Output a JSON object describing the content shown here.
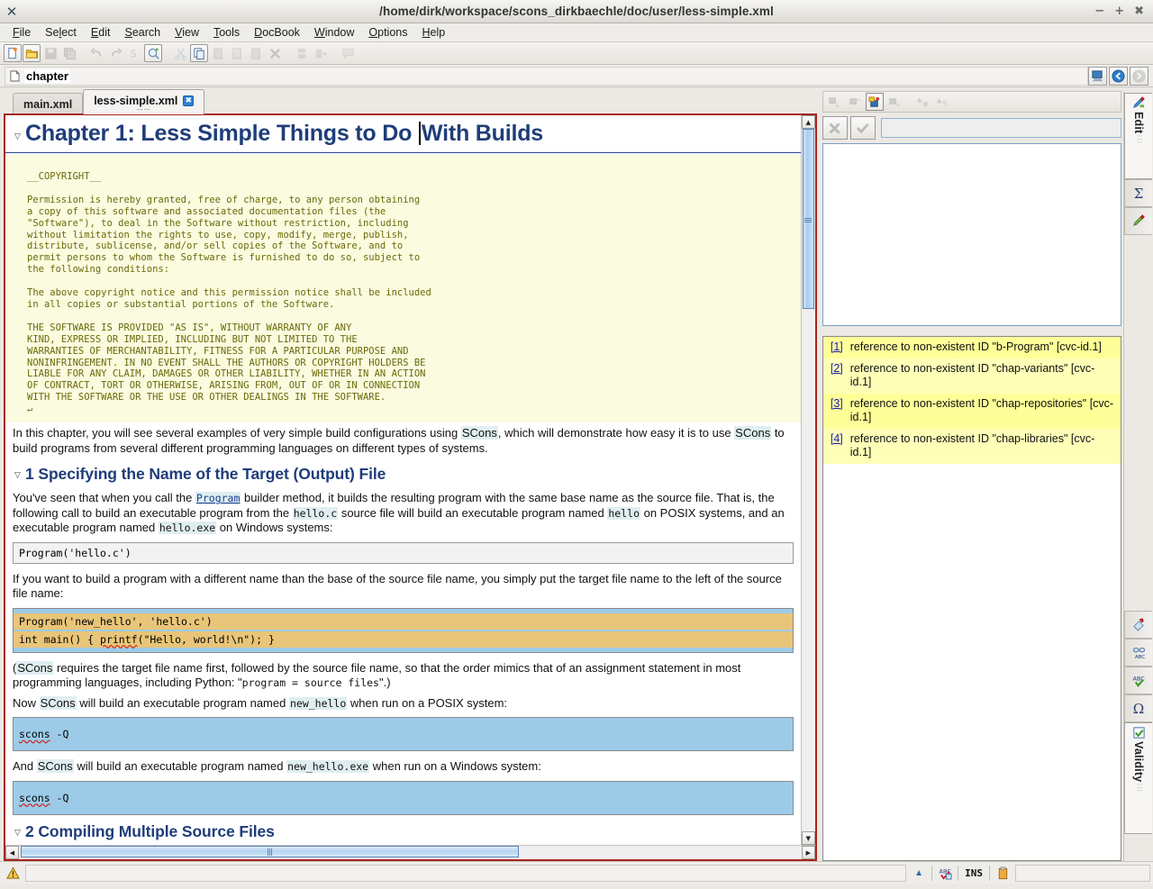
{
  "window": {
    "title": "/home/dirk/workspace/scons_dirkbaechle/doc/user/less-simple.xml",
    "app_icon": "x-icon",
    "minimize": "−",
    "maximize": "+",
    "close": "✖"
  },
  "menubar": {
    "items": [
      {
        "label": "File",
        "accel": "F"
      },
      {
        "label": "Select",
        "accel": "l"
      },
      {
        "label": "Edit",
        "accel": "E"
      },
      {
        "label": "Search",
        "accel": "S"
      },
      {
        "label": "View",
        "accel": "V"
      },
      {
        "label": "Tools",
        "accel": "T"
      },
      {
        "label": "DocBook",
        "accel": "D"
      },
      {
        "label": "Window",
        "accel": "W"
      },
      {
        "label": "Options",
        "accel": "O"
      },
      {
        "label": "Help",
        "accel": "H"
      }
    ]
  },
  "toolbar": {
    "buttons": [
      {
        "name": "new-file-icon",
        "enabled": true
      },
      {
        "name": "open-folder-icon",
        "enabled": true
      },
      {
        "name": "save-icon",
        "enabled": false
      },
      {
        "name": "save-all-icon",
        "enabled": false
      },
      {
        "name": "undo-icon",
        "enabled": false
      },
      {
        "name": "redo-icon",
        "enabled": false
      },
      {
        "name": "spellcheck-icon",
        "enabled": false
      },
      {
        "name": "search-preview-icon",
        "enabled": true
      },
      {
        "name": "cut-icon",
        "enabled": false
      },
      {
        "name": "copy-icon",
        "enabled": true
      },
      {
        "name": "paste-before-icon",
        "enabled": false
      },
      {
        "name": "paste-icon",
        "enabled": false
      },
      {
        "name": "paste-after-icon",
        "enabled": false
      },
      {
        "name": "delete-icon",
        "enabled": false
      },
      {
        "name": "split-icon",
        "enabled": false
      },
      {
        "name": "join-icon",
        "enabled": false
      },
      {
        "name": "comment-icon",
        "enabled": false
      }
    ]
  },
  "breadcrumb": {
    "path_icon": "document-icon",
    "label": "chapter",
    "right_buttons": [
      "screen-icon",
      "back-icon",
      "forward-icon"
    ]
  },
  "tabs": [
    {
      "label": "main.xml",
      "active": false,
      "closable": false
    },
    {
      "label": "less-simple.xml",
      "active": true,
      "closable": true,
      "close_glyph": "✖"
    }
  ],
  "document": {
    "chapter_heading_before_caret": "Chapter 1: Less Simple Things to Do ",
    "chapter_heading_after_caret": "With Builds",
    "comment_block": "__COPYRIGHT__\n\nPermission is hereby granted, free of charge, to any person obtaining\na copy of this software and associated documentation files (the\n\"Software\"), to deal in the Software without restriction, including\nwithout limitation the rights to use, copy, modify, merge, publish,\ndistribute, sublicense, and/or sell copies of the Software, and to\npermit persons to whom the Software is furnished to do so, subject to\nthe following conditions:\n\nThe above copyright notice and this permission notice shall be included\nin all copies or substantial portions of the Software.\n\nTHE SOFTWARE IS PROVIDED \"AS IS\", WITHOUT WARRANTY OF ANY\nKIND, EXPRESS OR IMPLIED, INCLUDING BUT NOT LIMITED TO THE\nWARRANTIES OF MERCHANTABILITY, FITNESS FOR A PARTICULAR PURPOSE AND\nNONINFRINGEMENT. IN NO EVENT SHALL THE AUTHORS OR COPYRIGHT HOLDERS BE\nLIABLE FOR ANY CLAIM, DAMAGES OR OTHER LIABILITY, WHETHER IN AN ACTION\nOF CONTRACT, TORT OR OTHERWISE, ARISING FROM, OUT OF OR IN CONNECTION\nWITH THE SOFTWARE OR THE USE OR OTHER DEALINGS IN THE SOFTWARE.",
    "comment_pilcrow": "↵",
    "intro_p1": "In this chapter, you will see several examples of very simple build configurations using ",
    "intro_scons1": "SCons",
    "intro_p2": ", which will demonstrate how easy it is to use ",
    "intro_scons2": "SCons",
    "intro_p3": " to build programs from several different programming languages on different types of systems.",
    "section1_title": "1 Specifying the Name of the Target (Output) File",
    "s1_p1_a": "You've seen that when you call the ",
    "s1_p1_program": "Program",
    "s1_p1_b": " builder method, it builds the resulting program with the same base name as the source file. That is, the following call to build an executable program from the ",
    "s1_p1_helloc": "hello.c",
    "s1_p1_c": " source file will build an executable program named ",
    "s1_p1_hello": "hello",
    "s1_p1_d": " on POSIX systems, and an executable program named ",
    "s1_p1_helloexe": "hello.exe",
    "s1_p1_e": " on Windows systems:",
    "code1": "Program('hello.c')",
    "s1_p2": "If you want to build a program with a different name than the base of the source file name, you simply put the target file name to the left of the source file name:",
    "code2_line1": "Program('new_hello', 'hello.c')",
    "code2_line2_a": "int main() { ",
    "code2_line2_printf": "printf",
    "code2_line2_b": "(\"Hello, world!\\n\"); }",
    "s1_p3_a": "(",
    "s1_p3_scons": "SCons",
    "s1_p3_b": " requires the target file name first, followed by the source file name, so that the order mimics that of an assignment statement in most programming languages, including Python: \"",
    "s1_p3_mono": "program = source files",
    "s1_p3_c": "\".)",
    "s1_p4_a": "Now ",
    "s1_p4_scons": "SCons",
    "s1_p4_b": " will build an executable program named ",
    "s1_p4_name": "new_hello",
    "s1_p4_c": " when run on a POSIX system:",
    "code3_cmd": "scons",
    "code3_arg": " -Q",
    "s1_p5_a": "And ",
    "s1_p5_scons": "SCons",
    "s1_p5_b": " will build an executable program named ",
    "s1_p5_name": "new_hello.exe",
    "s1_p5_c": " when run on a Windows system:",
    "code4_cmd": "scons",
    "code4_arg": " -Q",
    "section2_title": "2 Compiling Multiple Source Files",
    "collapse_glyph": "▽"
  },
  "right_panel": {
    "toolbar_buttons": [
      {
        "name": "node-insert-before-icon",
        "active": false
      },
      {
        "name": "node-insert-child-icon",
        "active": false
      },
      {
        "name": "node-insert-highlight-icon",
        "active": true
      },
      {
        "name": "node-insert-after-icon",
        "active": false
      },
      {
        "name": "shapes-filter-icon",
        "active": false
      },
      {
        "name": "shapes-sort-icon",
        "active": false
      }
    ],
    "cancel_icon": "x-mark-icon",
    "accept_icon": "check-mark-icon",
    "input_value": "",
    "input_placeholder": "",
    "problems": [
      {
        "num": "[1]",
        "text": "reference to non-existent ID \"b-Program\" [cvc-id.1]"
      },
      {
        "num": "[2]",
        "text": "reference to non-existent ID \"chap-variants\" [cvc-id.1]"
      },
      {
        "num": "[3]",
        "text": "reference to non-existent ID \"chap-repositories\" [cvc-id.1]"
      },
      {
        "num": "[4]",
        "text": "reference to non-existent ID \"chap-libraries\" [cvc-id.1]"
      }
    ]
  },
  "rail": {
    "top_tab": {
      "label": "Edit",
      "icon": "pencil-edit-icon",
      "dots": "⁞⁞⁞"
    },
    "top_buttons": [
      {
        "name": "sigma-icon",
        "glyph": "Σ"
      },
      {
        "name": "pencil-green-icon",
        "glyph": ""
      }
    ],
    "bottom_buttons": [
      {
        "name": "spell-tag-icon"
      },
      {
        "name": "abc-glasses-icon"
      },
      {
        "name": "abc-check-icon"
      },
      {
        "name": "omega-icon",
        "glyph": "Ω"
      }
    ],
    "bottom_tab": {
      "label": "Validity",
      "icon": "validity-check-icon",
      "dots": "⁞⁞⁞"
    }
  },
  "statusbar": {
    "warning_icon": "warning-triangle-icon",
    "message": "",
    "indicators": [
      {
        "name": "caret-up-icon",
        "glyph": "▲"
      },
      {
        "name": "spellcheck-status-icon",
        "glyph": ""
      },
      {
        "name": "insert-mode-indicator",
        "glyph": "INS"
      },
      {
        "name": "clipboard-icon",
        "glyph": ""
      }
    ]
  },
  "colors": {
    "heading": "#1f3d7a",
    "comment_text": "#6a6a0a",
    "comment_bg": "#fbfbdf",
    "code_blue": "#9ccbe8",
    "code_orange": "#e8c578",
    "problem_yellow": "#ffff99",
    "editor_border": "#a8241d",
    "inline_code_bg": "#dfeef0"
  }
}
